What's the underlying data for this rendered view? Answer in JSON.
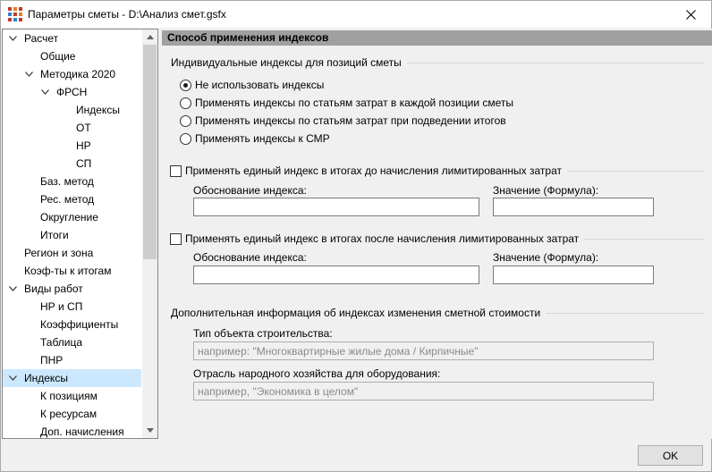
{
  "window": {
    "title": "Параметры сметы - D:\\Анализ смет.gsfx",
    "icons": {
      "app": "app-grid-icon",
      "close": "close-icon"
    }
  },
  "tree": {
    "items": [
      {
        "label": "Расчет",
        "expanded": true
      },
      {
        "label": "Общие"
      },
      {
        "label": "Методика 2020",
        "expanded": true
      },
      {
        "label": "ФРСН",
        "expanded": true
      },
      {
        "label": "Индексы"
      },
      {
        "label": "ОТ"
      },
      {
        "label": "НР"
      },
      {
        "label": "СП"
      },
      {
        "label": "Баз. метод"
      },
      {
        "label": "Рес. метод"
      },
      {
        "label": "Округление"
      },
      {
        "label": "Итоги"
      },
      {
        "label": "Регион и зона"
      },
      {
        "label": "Коэф-ты к итогам"
      },
      {
        "label": "Виды работ",
        "expanded": true
      },
      {
        "label": "НР и СП"
      },
      {
        "label": "Коэффициенты"
      },
      {
        "label": "Таблица"
      },
      {
        "label": "ПНР"
      },
      {
        "label": "Индексы",
        "expanded": true,
        "selected": true
      },
      {
        "label": "К позициям"
      },
      {
        "label": "К ресурсам"
      },
      {
        "label": "Доп. начисления"
      }
    ]
  },
  "panel": {
    "header": "Способ применения индексов",
    "individual": {
      "title": "Индивидуальные индексы для позиций сметы",
      "options": [
        {
          "label": "Не использовать индексы",
          "checked": true
        },
        {
          "label": "Применять индексы по статьям затрат в каждой позиции сметы",
          "checked": false
        },
        {
          "label": "Применять индексы по статьям затрат при подведении итогов",
          "checked": false
        },
        {
          "label": "Применять индексы к СМР",
          "checked": false
        }
      ]
    },
    "single_before": {
      "checkbox_label": "Применять единый индекс в итогах до начисления лимитированных затрат",
      "checked": false,
      "reason_label": "Обоснование индекса:",
      "reason_value": "",
      "value_label": "Значение (Формула):",
      "value_value": ""
    },
    "single_after": {
      "checkbox_label": "Применять единый индекс в итогах после начисления лимитированных затрат",
      "checked": false,
      "reason_label": "Обоснование индекса:",
      "reason_value": "",
      "value_label": "Значение (Формула):",
      "value_value": ""
    },
    "additional": {
      "title": "Дополнительная информация об индексах изменения сметной стоимости",
      "object_type_label": "Тип объекта строительства:",
      "object_type_placeholder": "например: \"Многоквартирные жилые дома / Кирпичные\"",
      "industry_label": "Отрасль народного хозяйства для оборудования:",
      "industry_placeholder": "например, \"Экономика в целом\""
    }
  },
  "footer": {
    "ok_label": "OK"
  }
}
